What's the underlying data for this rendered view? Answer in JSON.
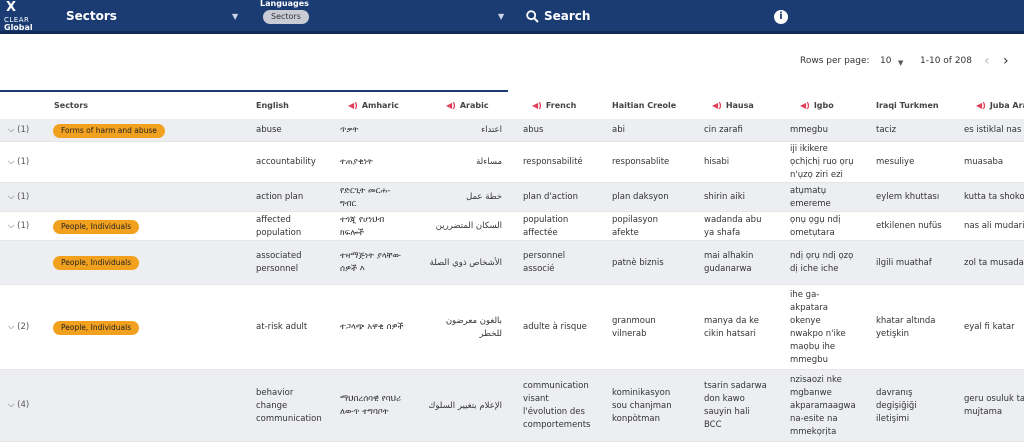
{
  "header": {
    "logo_line1": "CLEAR",
    "logo_line2": "Global",
    "sectors_label": "Sectors",
    "languages_label": "Languages",
    "languages_chip": "Sectors",
    "search_label": "Search",
    "info_glyph": "i"
  },
  "pager": {
    "rows_per_page_label": "Rows per page:",
    "rows_per_page_value": "10",
    "range": "1-10 of 208"
  },
  "columns": [
    "Sectors",
    "English",
    "Amharic",
    "Arabic",
    "French",
    "Haitian Creole",
    "Hausa",
    "Igbo",
    "Iraqi Turkmen",
    "Juba Arabic"
  ],
  "rows": [
    {
      "expand": "(1)",
      "sector": "Forms of harm and abuse",
      "en": [
        "abuse"
      ],
      "am": [
        "ጥቃት"
      ],
      "ar": [
        "اعتداء"
      ],
      "fr": [
        "abus"
      ],
      "ht": [
        "abi"
      ],
      "ha": [
        "cin zarafi"
      ],
      "ig": [
        "mmegbu"
      ],
      "tk": [
        "taciz"
      ],
      "ju": [
        "es istiklal nas"
      ]
    },
    {
      "expand": "(1)",
      "sector": "",
      "en": [
        "accountability"
      ],
      "am": [
        "ተጠያቂነት"
      ],
      "ar": [
        "مساءلة"
      ],
      "fr": [
        "responsabilité"
      ],
      "ht": [
        "responsablite"
      ],
      "ha": [
        "hisabi"
      ],
      "ig": [
        "iji ikikere",
        "ọchịchị ruo ọrụ",
        "n'ụzọ ziri ezi"
      ],
      "tk": [
        "mesuliye"
      ],
      "ju": [
        "muasaba"
      ]
    },
    {
      "expand": "(1)",
      "sector": "",
      "en": [
        "action plan"
      ],
      "am": [
        "የድርጊት መርሐ-",
        "ግብር"
      ],
      "ar": [
        "خطة عمل"
      ],
      "fr": [
        "plan d'action"
      ],
      "ht": [
        "plan daksyon"
      ],
      "ha": [
        "shirin aiki"
      ],
      "ig": [
        "atụmatụ",
        "emereme"
      ],
      "tk": [
        "eylem khuttası"
      ],
      "ju": [
        "kutta ta shokol"
      ]
    },
    {
      "expand": "(1)",
      "sector": "People, Individuals",
      "en": [
        "affected",
        "population"
      ],
      "am": [
        "ተጎጂ የሆነህብ",
        "ክፍሎች"
      ],
      "ar": [
        "السكان المتضررين"
      ],
      "fr": [
        "population",
        "affectée"
      ],
      "ht": [
        "popilasyon",
        "afekte"
      ],
      "ha": [
        "wadanda abu",
        "ya shafa"
      ],
      "ig": [
        "ọnụ ọgụ ndị",
        "ometụtara"
      ],
      "tk": [
        "etkilenen nufüs"
      ],
      "ju": [
        "nas ali mudarir"
      ]
    },
    {
      "expand": "",
      "sector": "People, Individuals",
      "en": [
        "associated",
        "personnel"
      ],
      "am": [
        "ተዛማጅነት ያላቸው",
        "ሰዎች እ"
      ],
      "ar": [
        "الأشخاص ذوي الصلة"
      ],
      "fr": [
        "personnel",
        "associé"
      ],
      "ht": [
        "patnè biznis"
      ],
      "ha": [
        "mai alhakin",
        "gudanarwa"
      ],
      "ig": [
        "ndị ọrụ ndị ọzọ",
        "dị iche iche"
      ],
      "tk": [
        "ilgili muathaf"
      ],
      "ju": [
        "zol ta musada"
      ]
    },
    {
      "expand": "(2)",
      "sector": "People, Individuals",
      "en": [
        "at-risk adult"
      ],
      "am": [
        "ተጋላጭ አዋቂ ሰዎች"
      ],
      "ar": [
        "بالغون معرضون",
        "للخطر"
      ],
      "fr": [
        "adulte à risque"
      ],
      "ht": [
        "granmoun",
        "vilnerab"
      ],
      "ha": [
        "manya da ke",
        "cikin hatsari"
      ],
      "ig": [
        "ihe ga-",
        "akpatara",
        "okenye",
        "nwakpo n'ike",
        "maọbụ ihe",
        "mmegbu"
      ],
      "tk": [
        "khatar altında",
        "yetişkin"
      ],
      "ju": [
        "eyal fi katar"
      ]
    },
    {
      "expand": "(4)",
      "sector": "",
      "en": [
        "behavior",
        "change",
        "communication"
      ],
      "am": [
        "ማህበረሰባዊ የባህሪ",
        "ለውጥ ተግባቦት"
      ],
      "ar": [
        "الإعلام بتغيير السلوك"
      ],
      "fr": [
        "communication",
        "visant",
        "l'évolution des",
        "comportements"
      ],
      "ht": [
        "kominikasyon",
        "sou chanjman",
        "konpòtman"
      ],
      "ha": [
        "tsarin sadarwa",
        "don kawo",
        "sauyin hali",
        "BCC"
      ],
      "ig": [
        "nzisaozi nke",
        "mgbanwe",
        "akparamaagwa",
        "na-esite na",
        "mmekọrịta"
      ],
      "tk": [
        "davranış",
        "degişiğiği",
        "iletişimi"
      ],
      "ju": [
        "geru osuluk ta",
        "mujtama"
      ]
    }
  ],
  "colors": {
    "header_bg": "#1b3b73",
    "badge": "#f2a11f",
    "speaker_icon": "#e0405a",
    "row_shade": "#edeef1"
  }
}
